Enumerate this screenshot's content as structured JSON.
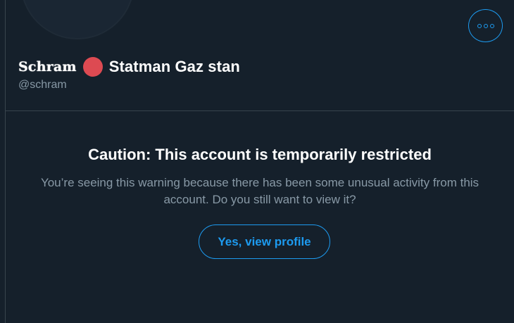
{
  "profile": {
    "display_name_styled": "Schram",
    "name_emoji_icon": "red-circle-icon",
    "display_name_rest": "Statman Gaz stan",
    "handle": "@schram"
  },
  "header": {
    "more_button_icon": "more-dots-icon"
  },
  "warning": {
    "title": "Caution: This account is temporarily restricted",
    "message": "You’re seeing this warning because there has been some unusual activity from this account. Do you still want to view it?",
    "button_label": "Yes, view profile"
  },
  "colors": {
    "background": "#15202b",
    "accent": "#1d9bf0",
    "secondary_text": "#8899a6",
    "divider": "#38444d",
    "red_circle": "#dd4a52"
  }
}
